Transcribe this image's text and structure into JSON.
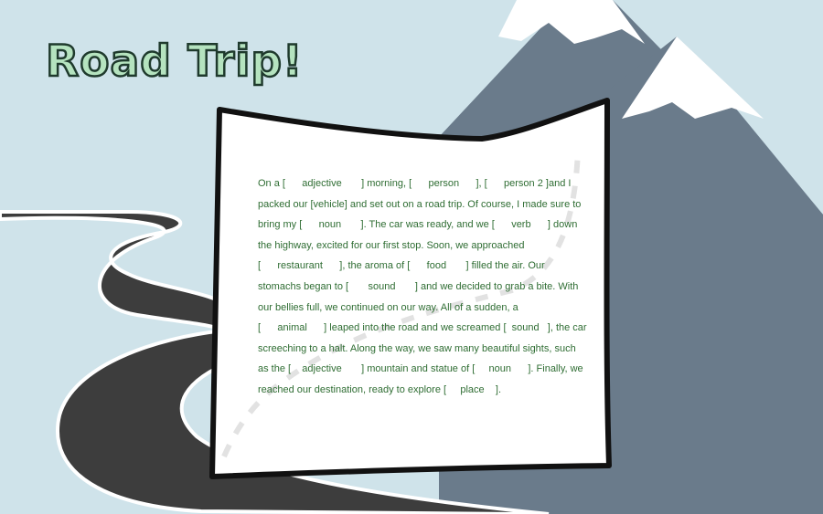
{
  "title": "Road Trip!",
  "story": [
    {
      "t": "On a "
    },
    {
      "b": "[      adjective       ]"
    },
    {
      "t": " morning, "
    },
    {
      "b": "[      person      ]"
    },
    {
      "t": ", "
    },
    {
      "b": "[      person 2 ]"
    },
    {
      "t": "and I packed our [vehicle] and set out on a road trip. Of course, I made sure to bring my "
    },
    {
      "b": "[      noun       ]"
    },
    {
      "t": ". The car was ready, and we "
    },
    {
      "b": "[      verb      ]"
    },
    {
      "t": " down the highway, excited for our first stop. Soon, we approached "
    },
    {
      "b": "[      restaurant      ]"
    },
    {
      "t": ", the aroma of "
    },
    {
      "b": "[      food       ]"
    },
    {
      "t": " filled the air. Our stomachs  began to "
    },
    {
      "b": "[       sound       ]"
    },
    {
      "t": " and we decided to grab a bite. With our bellies full, we continued on our way. All of a sudden, a "
    },
    {
      "b": "[      animal      ]"
    },
    {
      "t": " leaped into the road and we screamed "
    },
    {
      "b": "[  sound   ]"
    },
    {
      "t": ", the car screeching to a halt. Along the way, we saw many beautiful sights, such as the "
    },
    {
      "b": "[    adjective       ]"
    },
    {
      "t": " mountain and statue of "
    },
    {
      "b": "[     noun      ]"
    },
    {
      "t": ". Finally, we reached our destination, ready to explore "
    },
    {
      "b": "[     place    ]"
    },
    {
      "t": "."
    }
  ],
  "colors": {
    "sky": "#cfe3ea",
    "mountain": "#6a7b8b",
    "snow": "#ffffff",
    "road": "#3b3b3b",
    "title_fill": "#b5e3bf",
    "text": "#2f6d33"
  }
}
